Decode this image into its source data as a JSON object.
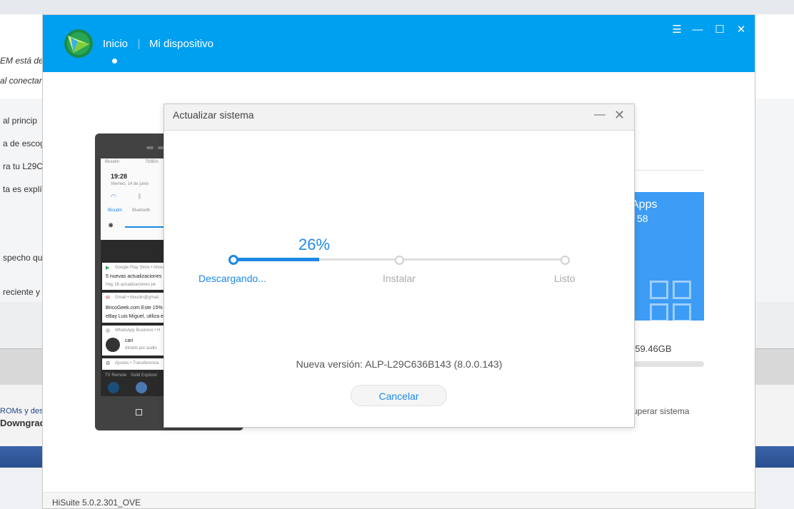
{
  "background": {
    "snippets": [
      "EM está des",
      "al conectar",
      "al princip",
      "a de escog",
      "ra tu L29C",
      "ta es explí",
      "specho qu",
      "reciente y",
      "ROMs y des",
      "Downgrad"
    ]
  },
  "app": {
    "nav": {
      "home": "Inicio",
      "device": "Mi dispositivo"
    },
    "controls": {
      "menu": "☰",
      "minimize": "—",
      "maximize": "☐",
      "close": "✕"
    },
    "version_footer": "HiSuite 5.0.2.301_OVE"
  },
  "phone": {
    "status_left": "Bloudin",
    "status_right": "793B/s",
    "time": "19:28",
    "date": "Viernes, 14 de junio",
    "toggles": [
      "Bloudin",
      "Bluetooth"
    ],
    "notifications": [
      {
        "app": "Google Play Store • Ahora",
        "title": "5 nuevas actualizaciones",
        "body": "Hay 16 actualizaciones pe"
      },
      {
        "app": "Gmail • bloudin@gmail.",
        "title": "BricoGeek.com Este 15%",
        "body": "eBay Luis Miguel, utiliza el"
      },
      {
        "app": "WhatsApp Business • H",
        "title": "cari",
        "body": "dímelo por audio"
      },
      {
        "app": "Ajustes • Transferencia",
        "title": "",
        "body": ""
      }
    ],
    "dock": [
      "TV Remote",
      "Solid Explorer"
    ]
  },
  "right_panel": {
    "apps_title": "Apps",
    "apps_count": "58",
    "storage": ": 59.46GB",
    "storage_fraction": 0.05,
    "recover": "uperar sistema"
  },
  "dialog": {
    "title": "Actualizar sistema",
    "minimize": "—",
    "close": "✕",
    "progress_percent": 26,
    "progress_label": "26%",
    "stages": [
      "Descargando...",
      "Instalar",
      "Listo"
    ],
    "new_version": "Nueva versión: ALP-L29C636B143 (8.0.0.143)",
    "cancel": "Cancelar"
  },
  "colors": {
    "header": "#00a0f0",
    "accent": "#1e88e5",
    "apps_tile": "#3c9cf6"
  }
}
